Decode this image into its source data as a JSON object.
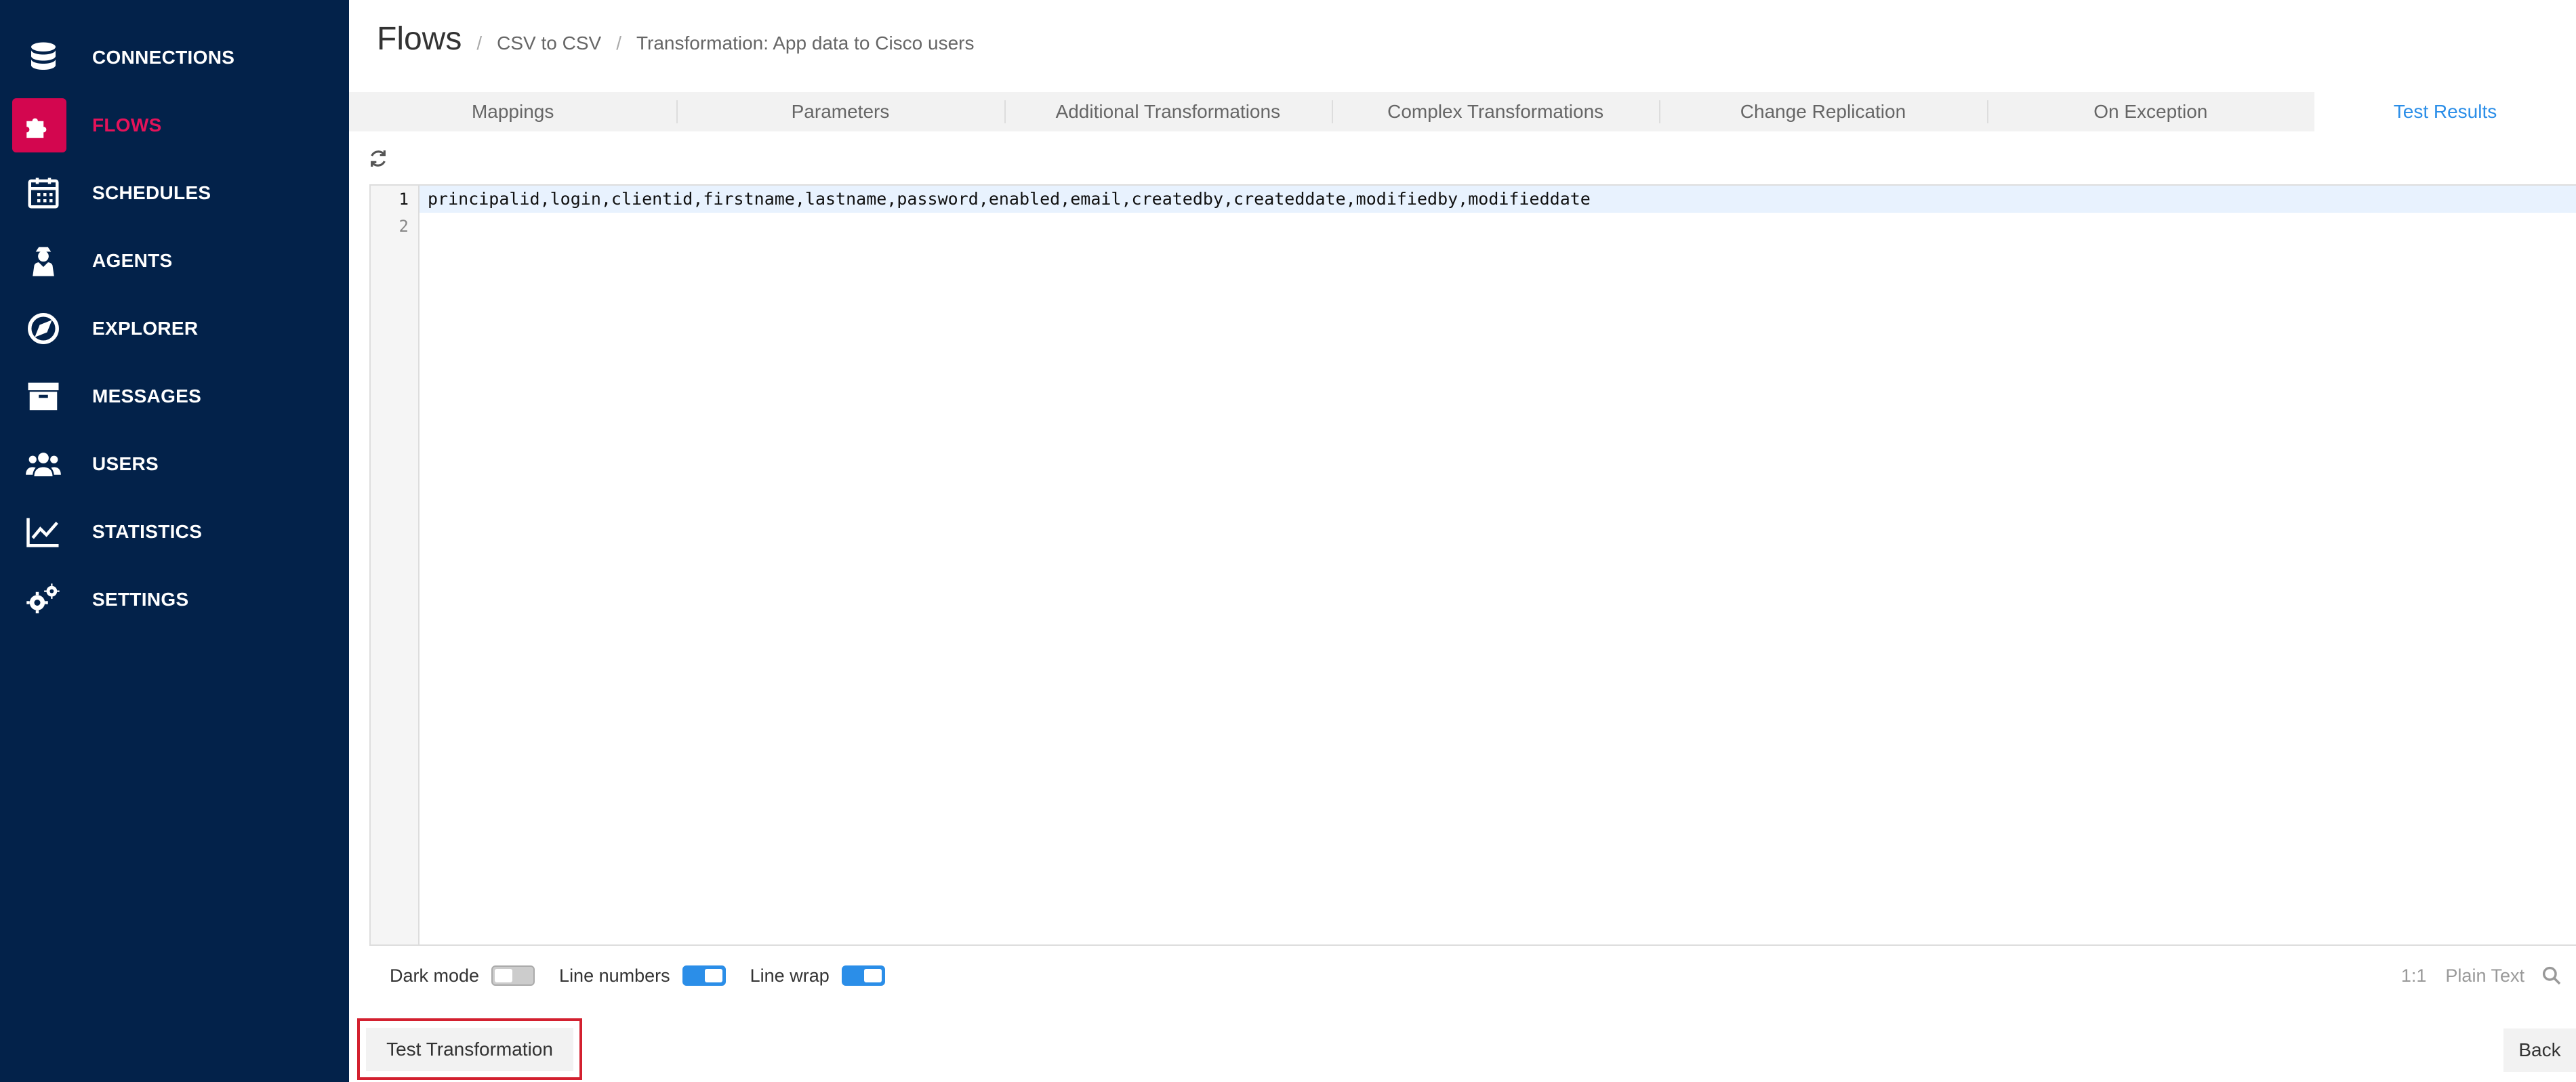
{
  "sidebar": {
    "items": [
      {
        "label": "CONNECTIONS",
        "icon": "database-icon"
      },
      {
        "label": "FLOWS",
        "icon": "puzzle-icon",
        "active": true
      },
      {
        "label": "SCHEDULES",
        "icon": "calendar-icon"
      },
      {
        "label": "AGENTS",
        "icon": "agent-icon"
      },
      {
        "label": "EXPLORER",
        "icon": "compass-icon"
      },
      {
        "label": "MESSAGES",
        "icon": "archive-icon"
      },
      {
        "label": "USERS",
        "icon": "users-icon"
      },
      {
        "label": "STATISTICS",
        "icon": "chart-line-icon"
      },
      {
        "label": "SETTINGS",
        "icon": "gears-icon"
      }
    ]
  },
  "header": {
    "title": "Flows",
    "breadcrumb": [
      "CSV to CSV",
      "Transformation: App data to Cisco users"
    ]
  },
  "tabs": [
    "Mappings",
    "Parameters",
    "Additional Transformations",
    "Complex Transformations",
    "Change Replication",
    "On Exception",
    "Test Results"
  ],
  "active_tab": "Test Results",
  "editor": {
    "line_numbers": [
      "1",
      "2"
    ],
    "lines": [
      "principalid,login,clientid,firstname,lastname,password,enabled,email,createdby,createddate,modifiedby,modifieddate",
      ""
    ]
  },
  "footer": {
    "dark_mode_label": "Dark mode",
    "line_numbers_label": "Line numbers",
    "line_wrap_label": "Line wrap",
    "dark_mode": false,
    "line_numbers": true,
    "line_wrap": true,
    "cursor_pos": "1:1",
    "mode": "Plain Text"
  },
  "buttons": {
    "test": "Test Transformation",
    "back": "Back"
  },
  "colors": {
    "sidebar_bg": "#03224a",
    "accent": "#d3064f",
    "active_tab": "#2b8ee8",
    "highlight_border": "#d3202f"
  }
}
